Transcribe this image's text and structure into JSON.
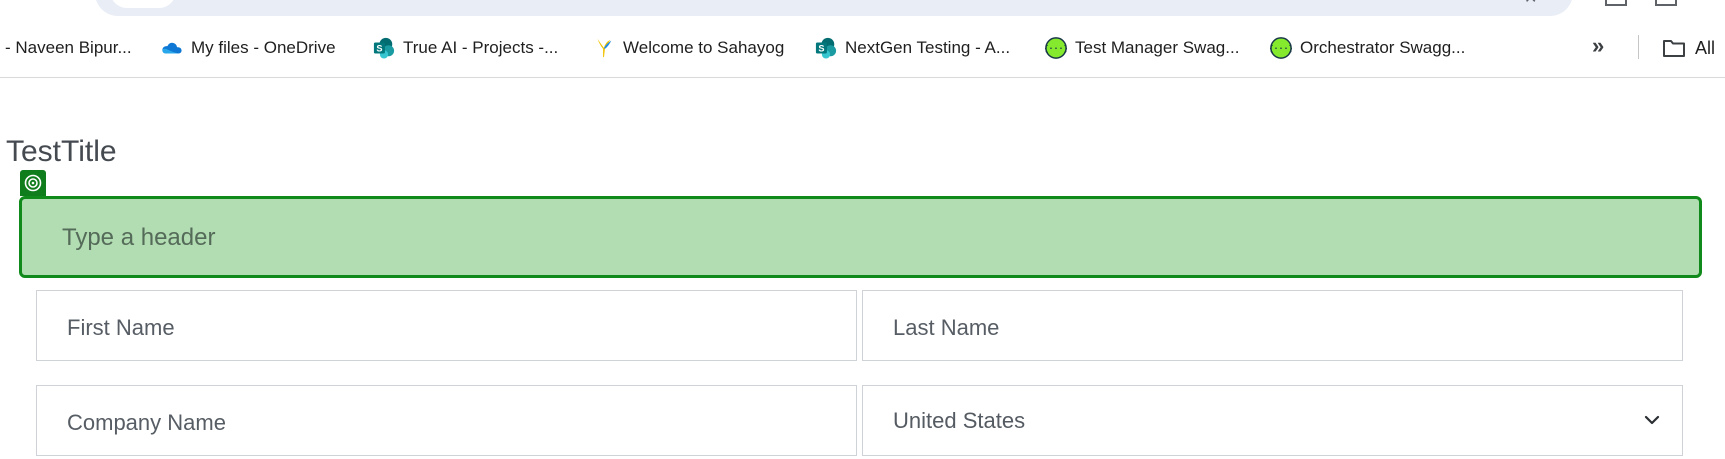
{
  "bookmarks": [
    {
      "label": "- Naveen Bipur...",
      "icon": "none"
    },
    {
      "label": "My files - OneDrive",
      "icon": "onedrive-icon"
    },
    {
      "label": "True AI - Projects -...",
      "icon": "sharepoint-icon"
    },
    {
      "label": "Welcome to Sahayog",
      "icon": "sahayog-icon"
    },
    {
      "label": "NextGen Testing - A...",
      "icon": "sharepoint-icon"
    },
    {
      "label": "Test Manager Swag...",
      "icon": "swagger-icon"
    },
    {
      "label": "Orchestrator Swagg...",
      "icon": "swagger-icon"
    }
  ],
  "bookmarks_overflow": "»",
  "all_bookmarks_label": "All",
  "page": {
    "title": "TestTitle"
  },
  "form": {
    "header_placeholder": "Type a header",
    "first_name_placeholder": "First Name",
    "last_name_placeholder": "Last Name",
    "company_placeholder": "Company Name",
    "country_value": "United States"
  },
  "colors": {
    "header_bg": "#b2ddb2",
    "header_border": "#108a1a",
    "badge_bg": "#0f7d1c"
  }
}
